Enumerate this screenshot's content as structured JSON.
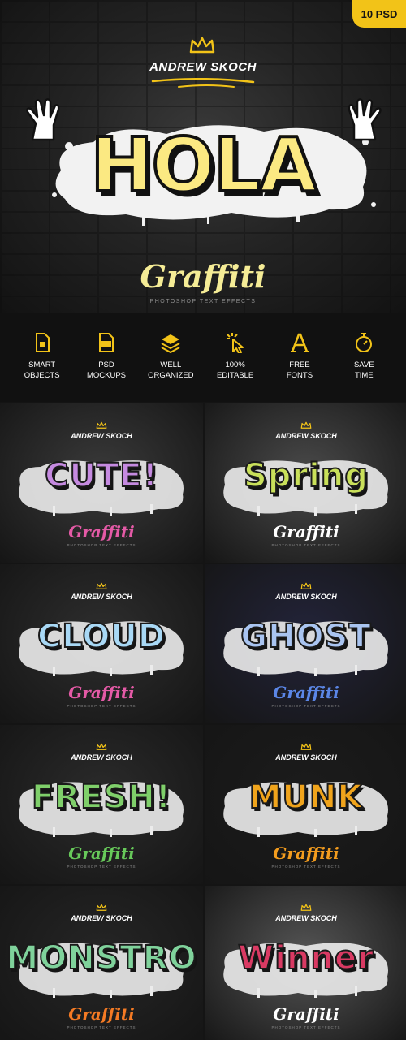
{
  "badge": "10 PSD",
  "hero": {
    "author": "ANDREW SKOCH",
    "title": "HOLA",
    "graffiti": "Graffiti",
    "subtitle": "PHOTOSHOP TEXT EFFECTS"
  },
  "features": [
    {
      "icon": "smart-objects-icon",
      "label": "SMART\nOBJECTS"
    },
    {
      "icon": "psd-mockups-icon",
      "label": "PSD\nMOCKUPS"
    },
    {
      "icon": "layers-icon",
      "label": "WELL\nORGANIZED"
    },
    {
      "icon": "cursor-click-icon",
      "label": "100%\nEDITABLE"
    },
    {
      "icon": "font-icon",
      "label": "FREE\nFONTS"
    },
    {
      "icon": "stopwatch-icon",
      "label": "SAVE\nTIME"
    }
  ],
  "colors": {
    "accent": "#f2c318",
    "hero_title": "#fbe982",
    "white": "#ffffff"
  },
  "tiles": [
    {
      "word": "CUTE!",
      "author": "ANDREW SKOCH",
      "graffiti": "Graffiti",
      "subtitle": "PHOTOSHOP TEXT EFFECTS",
      "word_color": "#c58ae0",
      "graffiti_color": "#e45aa6",
      "bg": "#3a3a3a"
    },
    {
      "word": "Spring",
      "author": "ANDREW SKOCH",
      "graffiti": "Graffiti",
      "subtitle": "PHOTOSHOP TEXT EFFECTS",
      "word_color": "#c9e05a",
      "graffiti_color": "#ffffff",
      "bg": "#4a4a4a"
    },
    {
      "word": "CLOUD",
      "author": "ANDREW SKOCH",
      "graffiti": "Graffiti",
      "subtitle": "PHOTOSHOP TEXT EFFECTS",
      "word_color": "#a8d8f5",
      "graffiti_color": "#e45aa6",
      "bg": "#2e2e2e"
    },
    {
      "word": "GHOST",
      "author": "ANDREW SKOCH",
      "graffiti": "Graffiti",
      "subtitle": "PHOTOSHOP TEXT EFFECTS",
      "word_color": "#a9c4f0",
      "graffiti_color": "#5b86e6",
      "bg": "#23243a"
    },
    {
      "word": "FRESH!",
      "author": "ANDREW SKOCH",
      "graffiti": "Graffiti",
      "subtitle": "PHOTOSHOP TEXT EFFECTS",
      "word_color": "#7fcf6a",
      "graffiti_color": "#67c95a",
      "bg": "#2b2b2b"
    },
    {
      "word": "MUNK",
      "author": "ANDREW SKOCH",
      "graffiti": "Graffiti",
      "subtitle": "PHOTOSHOP TEXT EFFECTS",
      "word_color": "#f0a41c",
      "graffiti_color": "#f39c1e",
      "bg": "#1c1c1c"
    },
    {
      "word": "MONSTRO",
      "author": "ANDREW SKOCH",
      "graffiti": "Graffiti",
      "subtitle": "PHOTOSHOP TEXT EFFECTS",
      "word_color": "#7fd29b",
      "graffiti_color": "#f47a24",
      "bg": "#262626"
    },
    {
      "word": "Winner",
      "author": "ANDREW SKOCH",
      "graffiti": "Graffiti",
      "subtitle": "PHOTOSHOP TEXT EFFECTS",
      "word_color": "#d93a63",
      "graffiti_color": "#ffffff",
      "bg": "#565656"
    }
  ]
}
